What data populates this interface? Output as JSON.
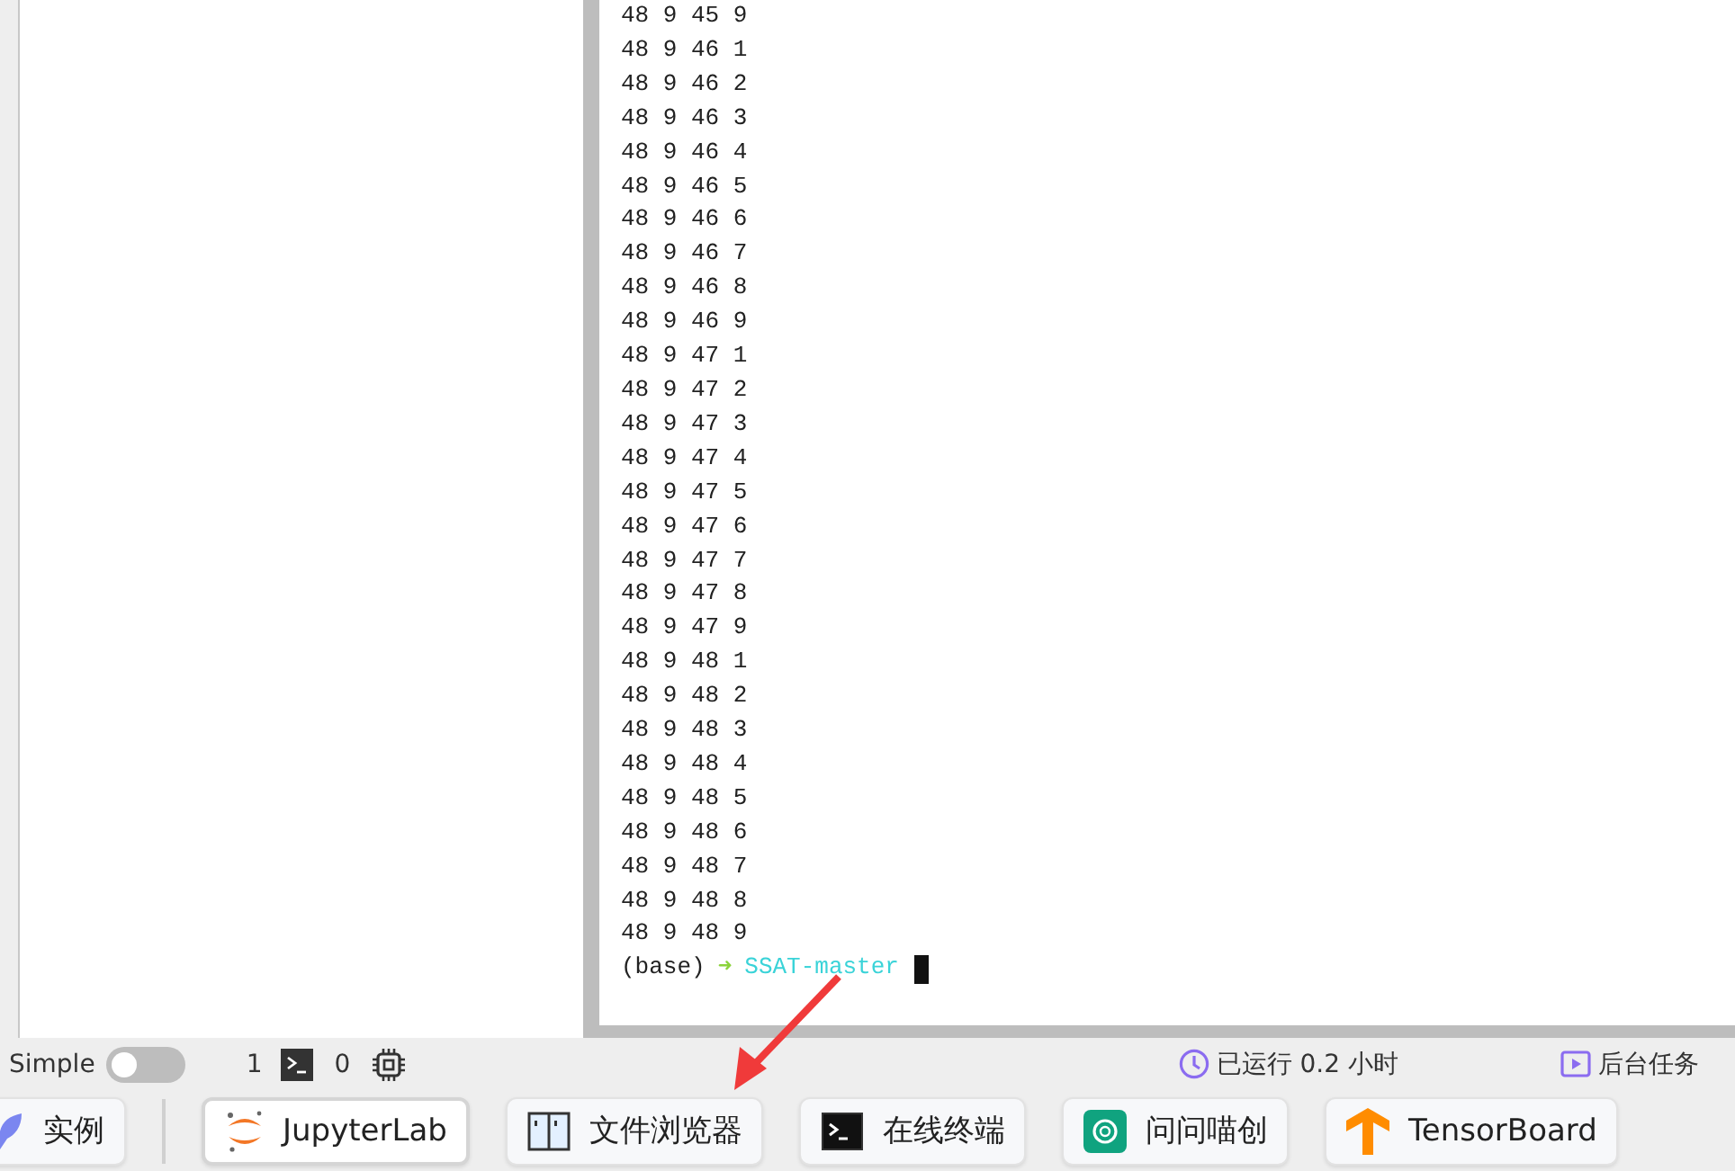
{
  "terminal": {
    "lines": [
      "48 9 45 9",
      "48 9 46 1",
      "48 9 46 2",
      "48 9 46 3",
      "48 9 46 4",
      "48 9 46 5",
      "48 9 46 6",
      "48 9 46 7",
      "48 9 46 8",
      "48 9 46 9",
      "48 9 47 1",
      "48 9 47 2",
      "48 9 47 3",
      "48 9 47 4",
      "48 9 47 5",
      "48 9 47 6",
      "48 9 47 7",
      "48 9 47 8",
      "48 9 47 9",
      "48 9 48 1",
      "48 9 48 2",
      "48 9 48 3",
      "48 9 48 4",
      "48 9 48 5",
      "48 9 48 6",
      "48 9 48 7",
      "48 9 48 8",
      "48 9 48 9"
    ],
    "prompt": {
      "env": "(base)",
      "arrow": "➜",
      "dir": "SSAT-master"
    }
  },
  "status_bar": {
    "mode_label": "Simple",
    "mode_on": false,
    "terminal_count": "1",
    "kernel_count": "0",
    "runtime": "已运行 0.2 小时",
    "background_tasks": "后台任务"
  },
  "launcher_tabs": [
    {
      "label": "实例",
      "kind": "instance",
      "selected": false
    },
    {
      "label": "JupyterLab",
      "kind": "jupyter",
      "selected": true
    },
    {
      "label": "文件浏览器",
      "kind": "files",
      "selected": false
    },
    {
      "label": "在线终端",
      "kind": "terminal",
      "selected": false
    },
    {
      "label": "问问喵创",
      "kind": "chat",
      "selected": false
    },
    {
      "label": "TensorBoard",
      "kind": "tensorboard",
      "selected": false
    }
  ]
}
